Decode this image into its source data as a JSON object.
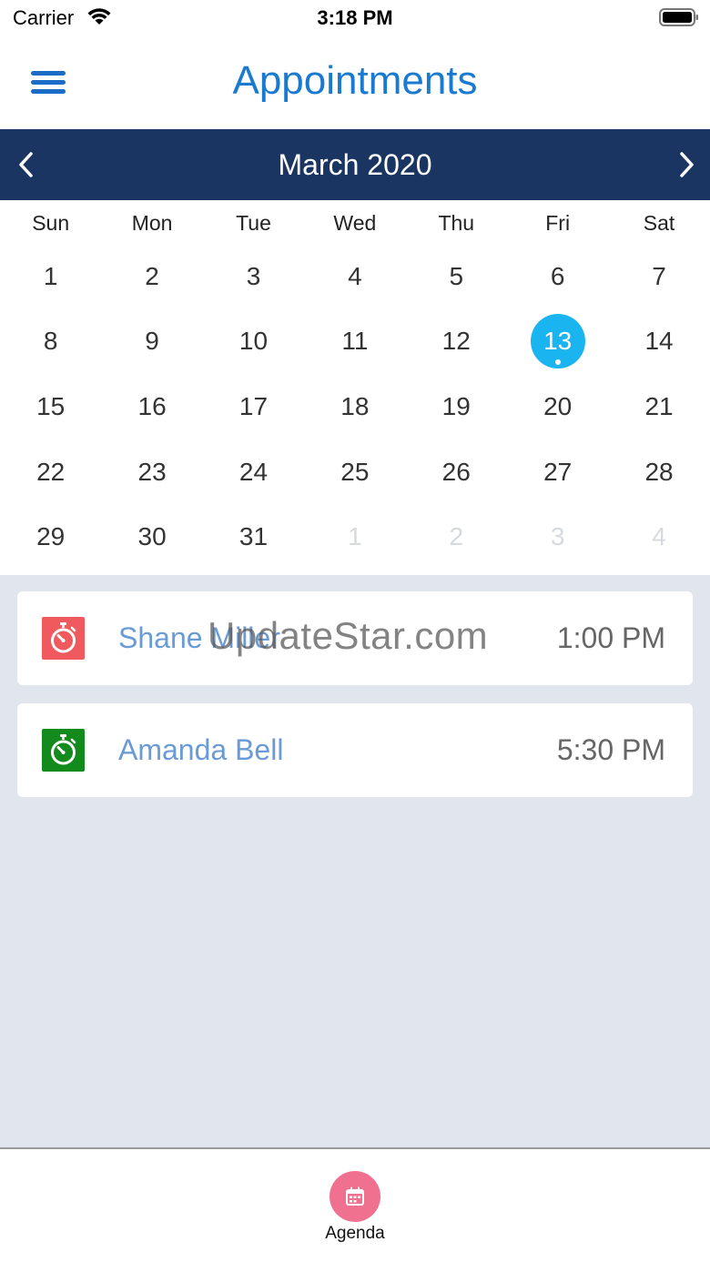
{
  "status_bar": {
    "carrier": "Carrier",
    "time": "3:18 PM"
  },
  "header": {
    "title": "Appointments",
    "menu_icon": "hamburger-menu-icon"
  },
  "calendar": {
    "month_label": "March 2020",
    "weekdays": [
      "Sun",
      "Mon",
      "Tue",
      "Wed",
      "Thu",
      "Fri",
      "Sat"
    ],
    "days": [
      "1",
      "2",
      "3",
      "4",
      "5",
      "6",
      "7",
      "8",
      "9",
      "10",
      "11",
      "12",
      "13",
      "14",
      "15",
      "16",
      "17",
      "18",
      "19",
      "20",
      "21",
      "22",
      "23",
      "24",
      "25",
      "26",
      "27",
      "28",
      "29",
      "30",
      "31",
      "1",
      "2",
      "3",
      "4"
    ],
    "selected_day": "13",
    "selected_color": "#1ab4f0"
  },
  "appointments": [
    {
      "name": "Shane Miller",
      "time": "1:00 PM",
      "icon": "stopwatch-icon",
      "icon_color": "#f05a5e"
    },
    {
      "name": "Amanda Bell",
      "time": "5:30 PM",
      "icon": "stopwatch-icon",
      "icon_color": "#138a1c"
    }
  ],
  "watermark": "UpdateStar.com",
  "tab_bar": {
    "agenda_label": "Agenda",
    "agenda_icon": "calendar-icon",
    "agenda_color": "#f0708f"
  },
  "colors": {
    "header_bar": "#1a3561",
    "title": "#1a7ad0",
    "list_background": "#e1e5ee"
  }
}
